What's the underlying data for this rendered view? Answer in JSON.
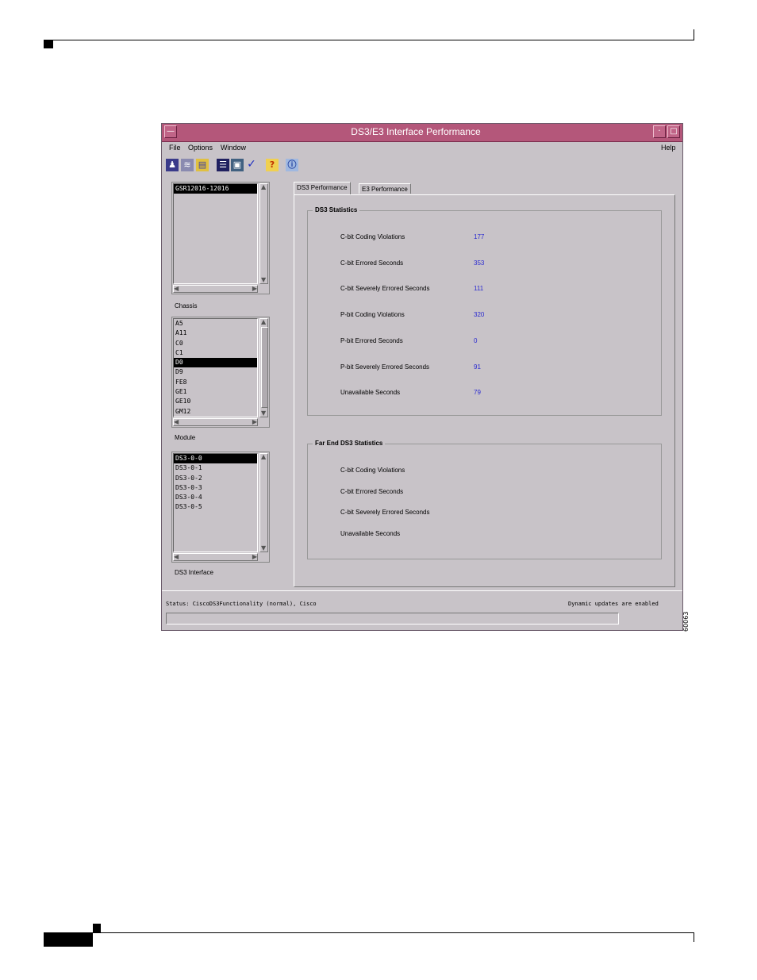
{
  "figure_id": "60063",
  "window": {
    "title": "DS3/E3 Interface Performance",
    "menu": {
      "file": "File",
      "options": "Options",
      "window": "Window",
      "help": "Help"
    },
    "toolbar_icons": [
      "person-icon",
      "stack-icon",
      "folder-icon",
      "list-icon",
      "monitor-icon",
      "check-icon",
      "question-icon",
      "info-icon"
    ]
  },
  "chassis": {
    "items": [
      "GSR12016-12016"
    ],
    "selected": 0,
    "label": "Chassis"
  },
  "module": {
    "items": [
      "A5",
      "A11",
      "C0",
      "C1",
      "D0",
      "D9",
      "FE8",
      "GE1",
      "GE10",
      "GM12"
    ],
    "selected": 4,
    "label": "Module"
  },
  "interface": {
    "items": [
      "DS3-0-0",
      "DS3-0-1",
      "DS3-0-2",
      "DS3-0-3",
      "DS3-0-4",
      "DS3-0-5"
    ],
    "selected": 0,
    "label": "DS3 Interface"
  },
  "tabs": {
    "ds3": "DS3 Performance",
    "e3": "E3 Performance"
  },
  "ds3_stats": {
    "title": "DS3 Statistics",
    "rows": [
      {
        "label": "C-bit Coding Violations",
        "value": "177"
      },
      {
        "label": "C-bit Errored Seconds",
        "value": "353"
      },
      {
        "label": "C-bit Severely Errored Seconds",
        "value": "111"
      },
      {
        "label": "P-bit Coding Violations",
        "value": "320"
      },
      {
        "label": "P-bit Errored Seconds",
        "value": "0"
      },
      {
        "label": "P-bit Severely Errored Seconds",
        "value": "91"
      },
      {
        "label": "Unavailable Seconds",
        "value": "79"
      }
    ]
  },
  "far_end_stats": {
    "title": "Far End DS3 Statistics",
    "rows": [
      {
        "label": "C-bit Coding Violations"
      },
      {
        "label": "C-bit Errored Seconds"
      },
      {
        "label": "C-bit Severely Errored Seconds"
      },
      {
        "label": "Unavailable Seconds"
      }
    ]
  },
  "status": {
    "left": "Status: CiscoDS3Functionality (normal), Cisco",
    "right": "Dynamic updates are enabled"
  }
}
